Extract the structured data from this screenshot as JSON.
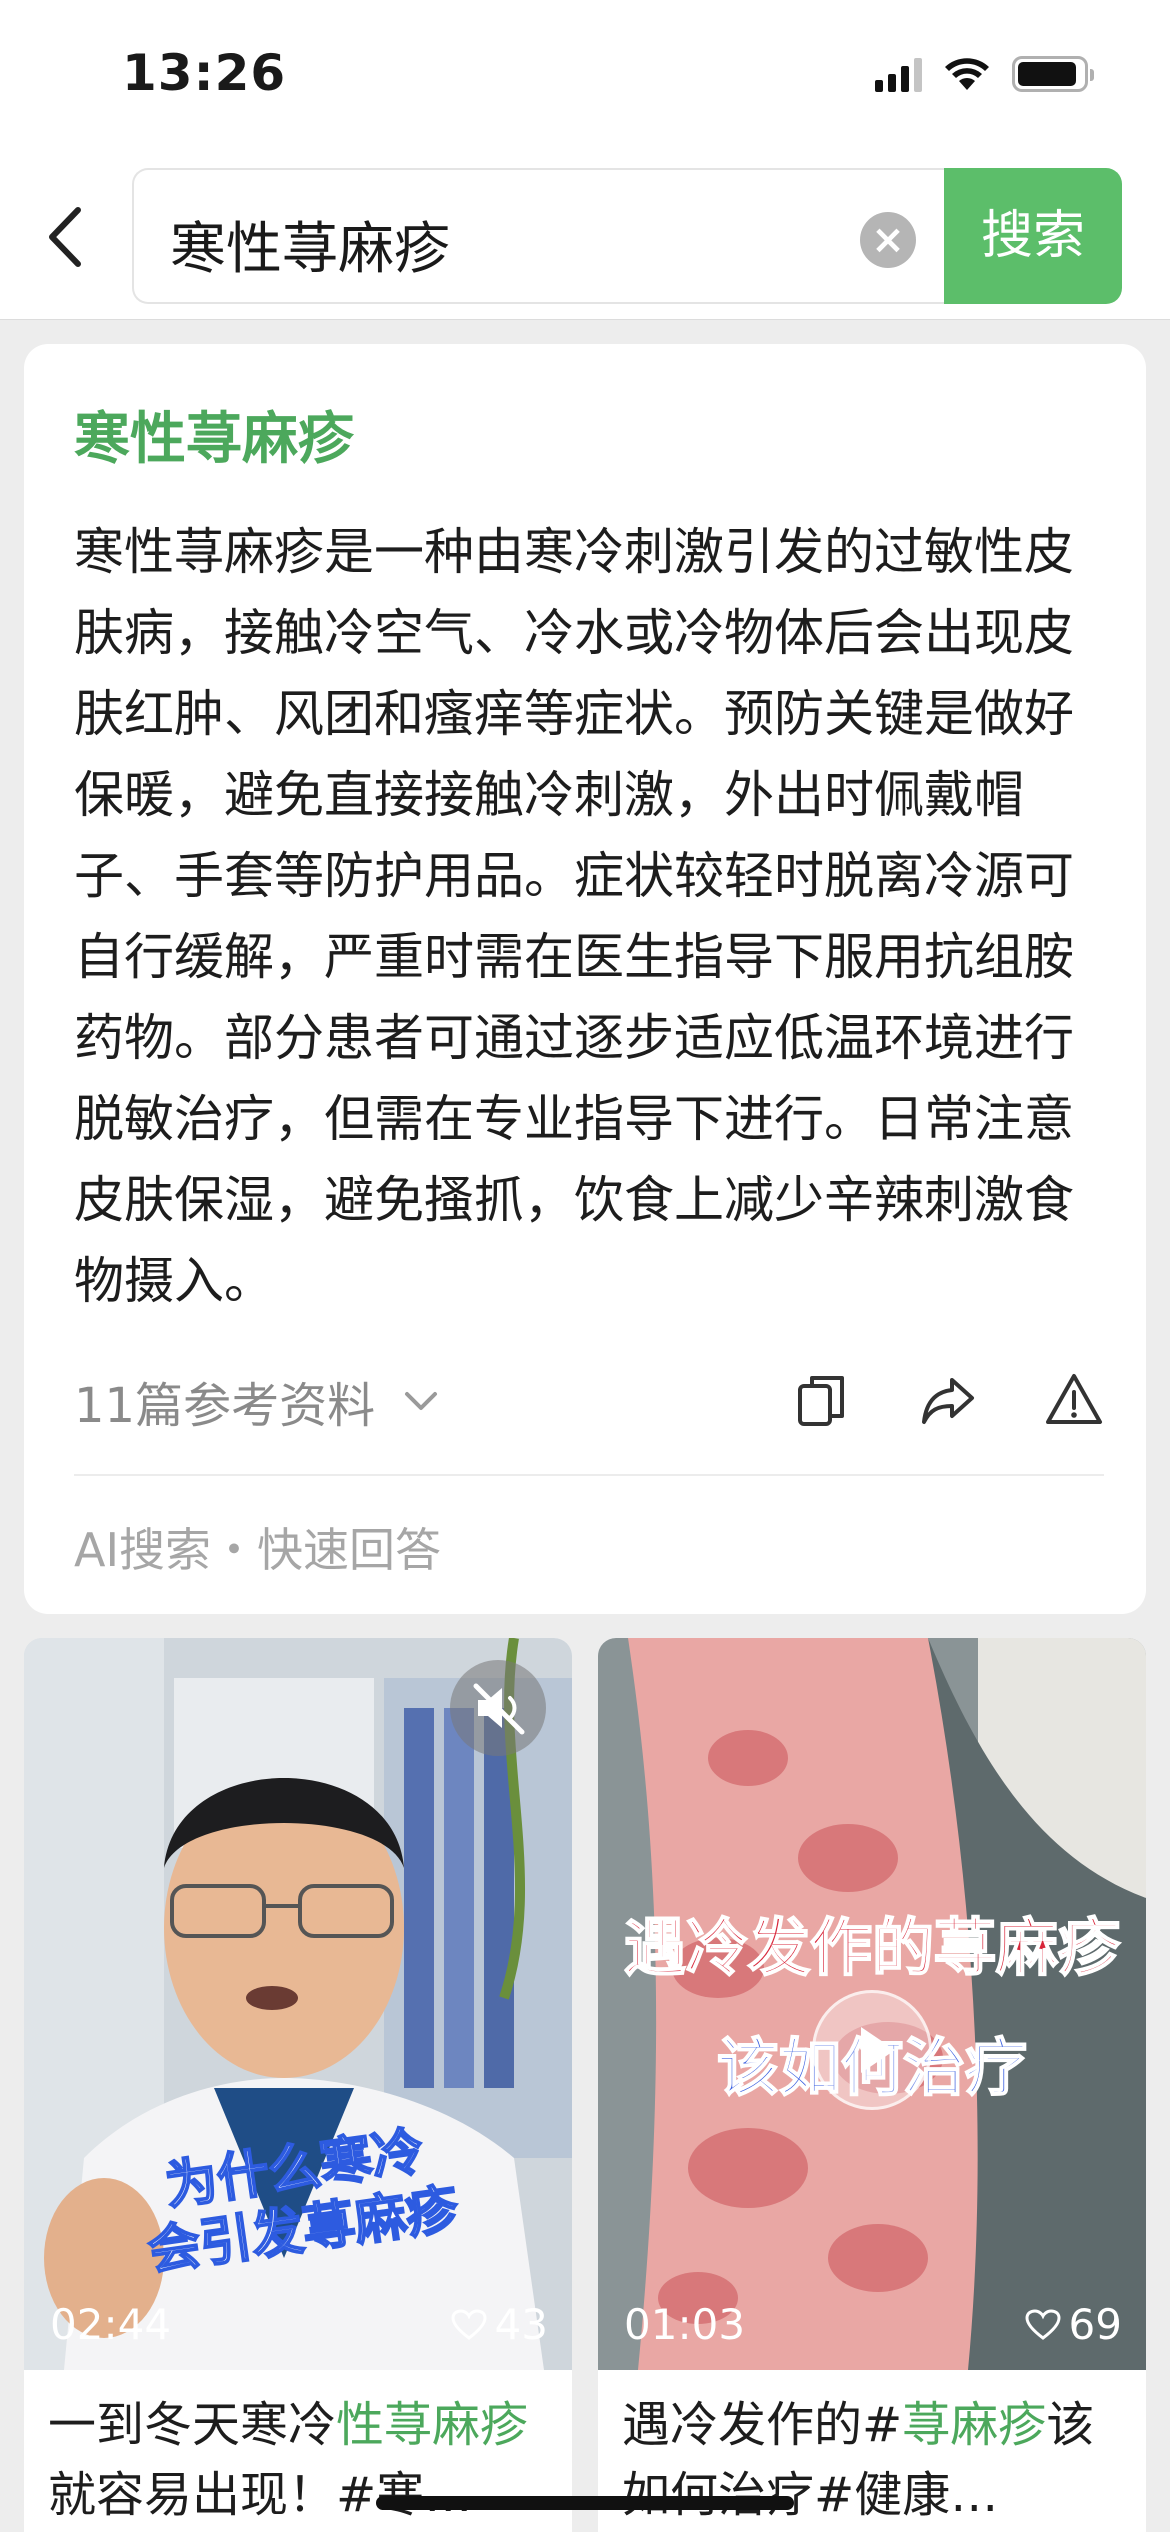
{
  "status_bar": {
    "time": "13:26",
    "battery_level": 0.9
  },
  "search": {
    "query": "寒性荨麻疹",
    "button_label": "搜索"
  },
  "answer": {
    "title": "寒性荨麻疹",
    "body": "寒性荨麻疹是一种由寒冷刺激引发的过敏性皮肤病，接触冷空气、冷水或冷物体后会出现皮肤红肿、风团和瘙痒等症状。预防关键是做好保暖，避免直接接触冷刺激，外出时佩戴帽子、手套等防护用品。症状较轻时脱离冷源可自行缓解，严重时需在医生指导下服用抗组胺药物。部分患者可通过逐步适应低温环境进行脱敏治疗，但需在专业指导下进行。日常注意皮肤保湿，避免搔抓，饮食上减少辛辣刺激食物摄入。",
    "references_label": "11篇参考资料",
    "source_label": "AI搜索・快速回答"
  },
  "videos": [
    {
      "duration": "02:44",
      "likes": "43",
      "overlay_text": [
        "为什么寒冷",
        "会引发荨麻疹"
      ],
      "caption_before": "一到冬天寒冷",
      "caption_highlight": "性荨麻疹",
      "caption_after": "就容易出现！#寒…"
    },
    {
      "duration": "01:03",
      "likes": "69",
      "overlay_text": [
        "遇冷发作的荨麻疹",
        "该如何治疗"
      ],
      "caption_before": "遇冷发作的#",
      "caption_highlight": "荨麻疹",
      "caption_after": "该如何治疗#健康…"
    }
  ],
  "colors": {
    "accent_green": "#5cbe6a",
    "title_green": "#4ca85c",
    "overlay_red": "#d8263a",
    "overlay_blue": "#3a5fe0"
  }
}
